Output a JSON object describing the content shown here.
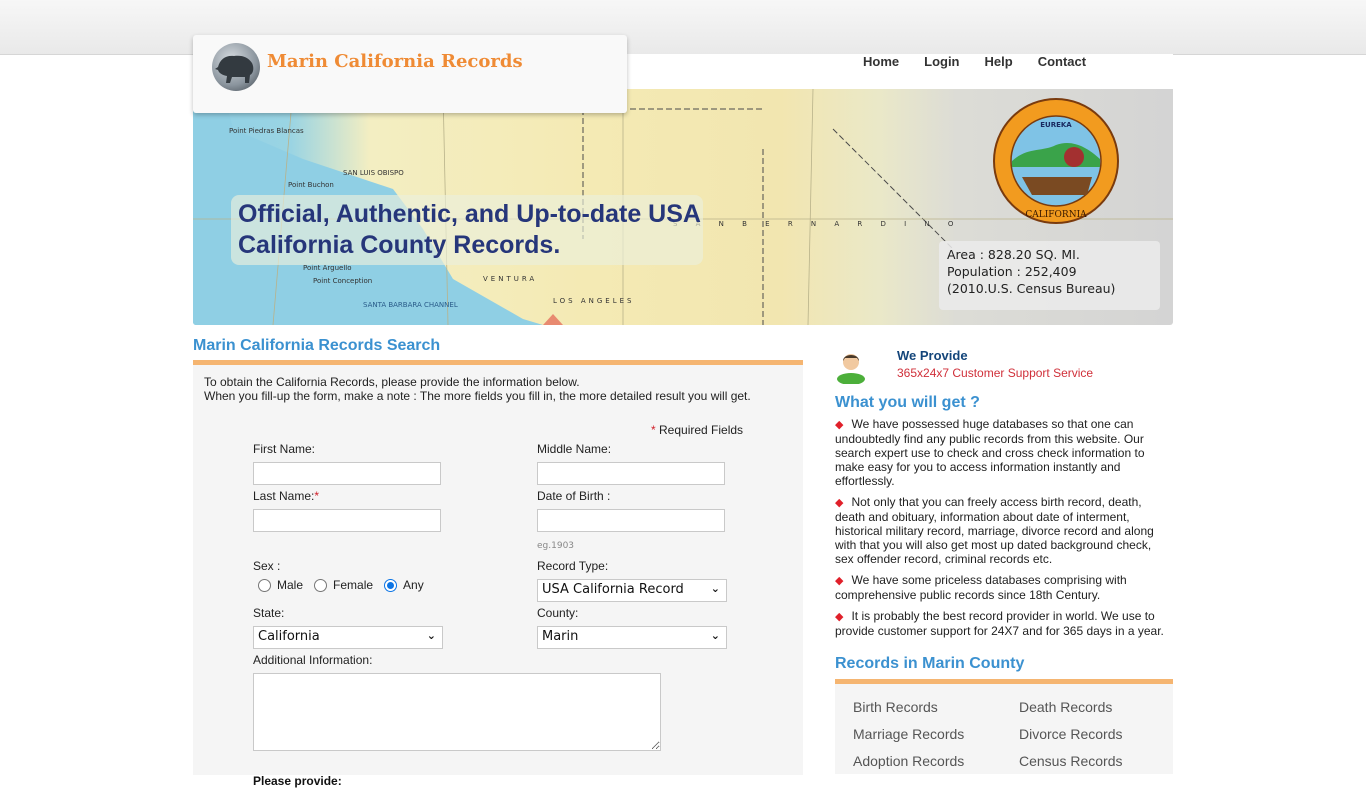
{
  "site": {
    "title": "Marin California Records"
  },
  "nav": {
    "items": [
      {
        "label": "Home"
      },
      {
        "label": "Login"
      },
      {
        "label": "Help"
      },
      {
        "label": "Contact"
      }
    ]
  },
  "banner": {
    "tagline": "Official, Authentic, and Up-to-date USA California County Records.",
    "seal_label": "Marin County Superior Court seal",
    "stats": {
      "area": "Area : 828.20 SQ. MI.",
      "population": "Population : 252,409",
      "source": "(2010.U.S. Census Bureau)"
    }
  },
  "search": {
    "title": "Marin California Records Search",
    "intro_line1": "To obtain the California Records, please provide the information below.",
    "intro_line2": "When you fill-up the form, make a note : The more fields you fill in, the more detailed result you will get.",
    "required_star": "*",
    "required_note": " Required Fields",
    "fields": {
      "first_name": {
        "label": "First Name:",
        "value": ""
      },
      "middle_name": {
        "label": "Middle Name:",
        "value": ""
      },
      "last_name": {
        "label": "Last Name:",
        "required": "*",
        "value": ""
      },
      "dob": {
        "label": "Date of Birth :",
        "value": "",
        "hint": "eg.1903"
      },
      "sex": {
        "label": "Sex :",
        "options": [
          {
            "label": "Male",
            "checked": false
          },
          {
            "label": "Female",
            "checked": false
          },
          {
            "label": "Any",
            "checked": true
          }
        ]
      },
      "record_type": {
        "label": "Record Type:",
        "selected": "USA California Record"
      },
      "state": {
        "label": "State:",
        "selected": "California"
      },
      "county": {
        "label": "County:",
        "selected": "Marin"
      },
      "additional": {
        "label": "Additional Information:",
        "value": ""
      }
    },
    "please_provide": "Please provide:"
  },
  "sidebar": {
    "provide_title": "We Provide",
    "provide_sub": "365x24x7 Customer Support Service",
    "get_title": "What you will get ?",
    "bullets": [
      "We have possessed huge databases so that one can undoubtedly find any public records from this website. Our search expert use to check and cross check information to make easy for you to access information instantly and effortlessly.",
      "Not only that you can freely access birth record, death, death and obituary, information about date of interment, historical military record, marriage, divorce record and along with that you will also get most up dated background check, sex offender record, criminal records etc.",
      "We have some priceless databases comprising with comprehensive public records since 18th Century.",
      "It is probably the best record provider in world. We use to provide customer support for 24X7 and for 365 days in a year."
    ],
    "records_title": "Records in Marin County",
    "records": [
      "Birth Records",
      "Death Records",
      "Marriage Records",
      "Divorce Records",
      "Adoption Records",
      "Census Records"
    ]
  },
  "colors": {
    "accent_blue": "#3b91d0",
    "accent_orange": "#f5b571",
    "logo_orange": "#ef8b35",
    "tagline_navy": "#26367a",
    "bullet_red": "#e0202a"
  }
}
